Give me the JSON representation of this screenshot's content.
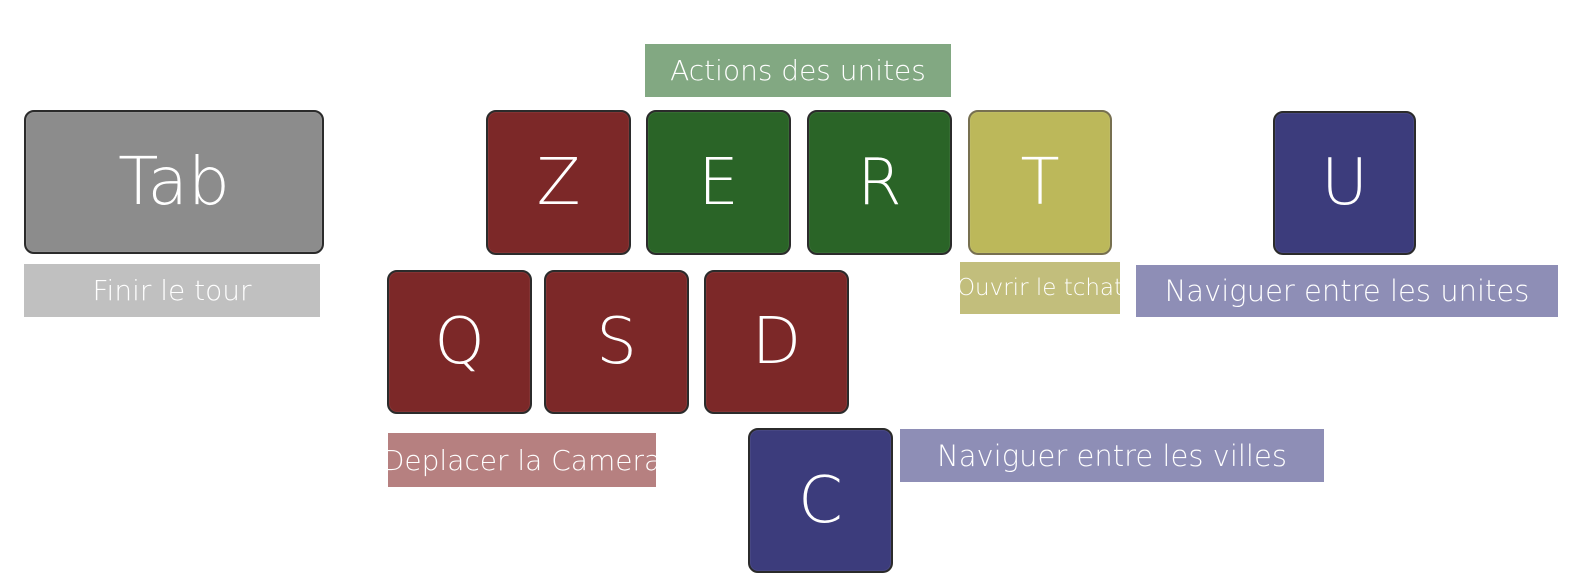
{
  "colors": {
    "red": "#7c2828",
    "green": "#2a6427",
    "yellow": "#bcb85a",
    "navy": "#3c3c7c",
    "gray": "#8c8c8c",
    "label_gray": "#c0c0c0",
    "label_green": "#82a882",
    "label_yellow": "#c2be7c",
    "label_purple": "#8e8eb6",
    "label_red": "#b68080"
  },
  "keys": {
    "tab": "Tab",
    "z": "Z",
    "e": "E",
    "r": "R",
    "t": "T",
    "u": "U",
    "q": "Q",
    "s": "S",
    "d": "D",
    "c": "C"
  },
  "labels": {
    "actions": "Actions des unites",
    "finir": "Finir le tour",
    "tchat": "Ouvrir le tchat",
    "unites": "Naviguer entre les unites",
    "camera": "Deplacer la Camera",
    "villes": "Naviguer entre les villes"
  }
}
